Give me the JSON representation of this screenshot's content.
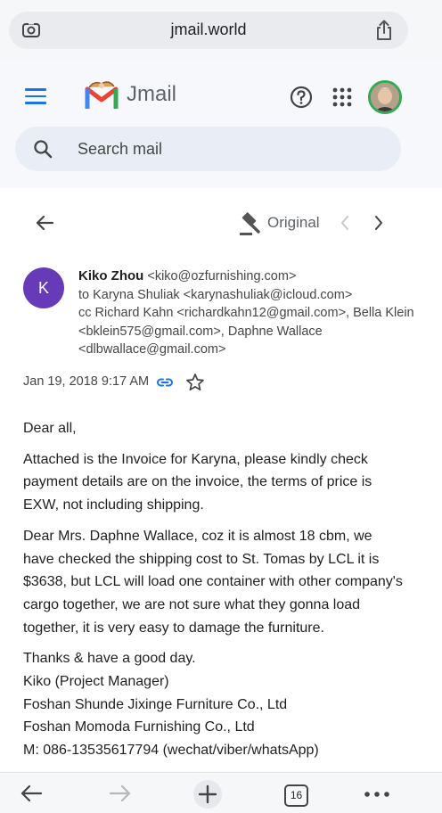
{
  "browser": {
    "url": "jmail.world",
    "tab_count": "16"
  },
  "app": {
    "logo_text": "Jmail",
    "search_placeholder": "Search mail"
  },
  "message_toolbar": {
    "original_label": "Original"
  },
  "message": {
    "avatar_letter": "K",
    "sender_name": "Kiko Zhou",
    "sender_email": "<kiko@ozfurnishing.com>",
    "to_line": "to Karyna Shuliak <karynashuliak@icloud.com>",
    "cc_line": "cc Richard Kahn <richardkahn12@gmail.com>, Bella Klein <bklein575@gmail.com>, Daphne Wallace <dlbwallace@gmail.com>",
    "date": "Jan 19, 2018 9:17 AM",
    "greeting": "Dear all,",
    "paragraph1": "Attached is the Invoice for Karyna, please kindly check payment details are on the invoice, the terms of price is EXW, not including shipping.",
    "paragraph2": "Dear Mrs. Daphne Wallace, coz it is almost 18 cbm, we have checked the shipping cost to St. Tomas by LCL it is $3638, but LCL will load one container with other company's cargo together, we are not sure what they gonna load together, it is very easy to damage the furniture.",
    "signature": [
      "Thanks & have a good day.",
      "Kiko (Project Manager)",
      "Foshan Shunde Jixinge Furniture Co., Ltd",
      "Foshan Momoda Furnishing Co., Ltd",
      "M: 086-13535617794 (wechat/viber/whatsApp)"
    ]
  }
}
